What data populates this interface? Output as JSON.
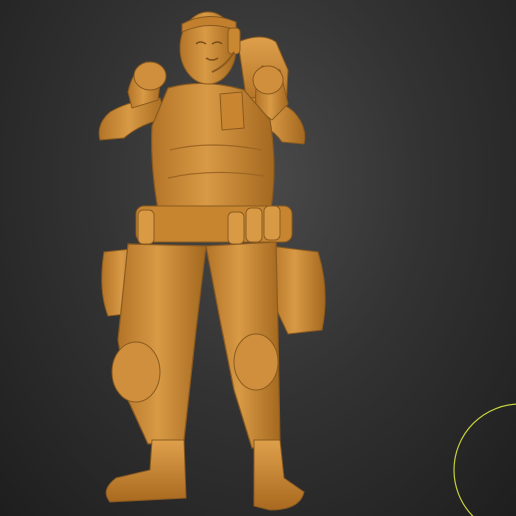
{
  "scene": {
    "subject": "sculpted-soldier-figure",
    "colors": {
      "clay": "#d08f3c",
      "clay_shadow": "#8a5a1f",
      "clay_highlight": "#e8ab55",
      "background_center": "#4a4a4a",
      "background_edge": "#1e1e1e",
      "gizmo": "#c8d23a"
    }
  }
}
